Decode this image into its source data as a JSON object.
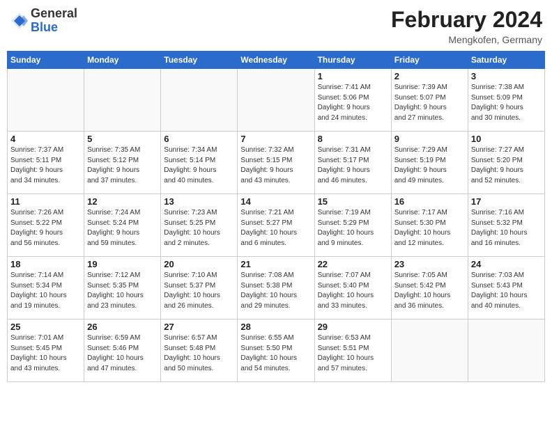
{
  "header": {
    "logo_general": "General",
    "logo_blue": "Blue",
    "month_year": "February 2024",
    "location": "Mengkofen, Germany"
  },
  "weekdays": [
    "Sunday",
    "Monday",
    "Tuesday",
    "Wednesday",
    "Thursday",
    "Friday",
    "Saturday"
  ],
  "weeks": [
    [
      {
        "day": "",
        "info": ""
      },
      {
        "day": "",
        "info": ""
      },
      {
        "day": "",
        "info": ""
      },
      {
        "day": "",
        "info": ""
      },
      {
        "day": "1",
        "info": "Sunrise: 7:41 AM\nSunset: 5:06 PM\nDaylight: 9 hours\nand 24 minutes."
      },
      {
        "day": "2",
        "info": "Sunrise: 7:39 AM\nSunset: 5:07 PM\nDaylight: 9 hours\nand 27 minutes."
      },
      {
        "day": "3",
        "info": "Sunrise: 7:38 AM\nSunset: 5:09 PM\nDaylight: 9 hours\nand 30 minutes."
      }
    ],
    [
      {
        "day": "4",
        "info": "Sunrise: 7:37 AM\nSunset: 5:11 PM\nDaylight: 9 hours\nand 34 minutes."
      },
      {
        "day": "5",
        "info": "Sunrise: 7:35 AM\nSunset: 5:12 PM\nDaylight: 9 hours\nand 37 minutes."
      },
      {
        "day": "6",
        "info": "Sunrise: 7:34 AM\nSunset: 5:14 PM\nDaylight: 9 hours\nand 40 minutes."
      },
      {
        "day": "7",
        "info": "Sunrise: 7:32 AM\nSunset: 5:15 PM\nDaylight: 9 hours\nand 43 minutes."
      },
      {
        "day": "8",
        "info": "Sunrise: 7:31 AM\nSunset: 5:17 PM\nDaylight: 9 hours\nand 46 minutes."
      },
      {
        "day": "9",
        "info": "Sunrise: 7:29 AM\nSunset: 5:19 PM\nDaylight: 9 hours\nand 49 minutes."
      },
      {
        "day": "10",
        "info": "Sunrise: 7:27 AM\nSunset: 5:20 PM\nDaylight: 9 hours\nand 52 minutes."
      }
    ],
    [
      {
        "day": "11",
        "info": "Sunrise: 7:26 AM\nSunset: 5:22 PM\nDaylight: 9 hours\nand 56 minutes."
      },
      {
        "day": "12",
        "info": "Sunrise: 7:24 AM\nSunset: 5:24 PM\nDaylight: 9 hours\nand 59 minutes."
      },
      {
        "day": "13",
        "info": "Sunrise: 7:23 AM\nSunset: 5:25 PM\nDaylight: 10 hours\nand 2 minutes."
      },
      {
        "day": "14",
        "info": "Sunrise: 7:21 AM\nSunset: 5:27 PM\nDaylight: 10 hours\nand 6 minutes."
      },
      {
        "day": "15",
        "info": "Sunrise: 7:19 AM\nSunset: 5:29 PM\nDaylight: 10 hours\nand 9 minutes."
      },
      {
        "day": "16",
        "info": "Sunrise: 7:17 AM\nSunset: 5:30 PM\nDaylight: 10 hours\nand 12 minutes."
      },
      {
        "day": "17",
        "info": "Sunrise: 7:16 AM\nSunset: 5:32 PM\nDaylight: 10 hours\nand 16 minutes."
      }
    ],
    [
      {
        "day": "18",
        "info": "Sunrise: 7:14 AM\nSunset: 5:34 PM\nDaylight: 10 hours\nand 19 minutes."
      },
      {
        "day": "19",
        "info": "Sunrise: 7:12 AM\nSunset: 5:35 PM\nDaylight: 10 hours\nand 23 minutes."
      },
      {
        "day": "20",
        "info": "Sunrise: 7:10 AM\nSunset: 5:37 PM\nDaylight: 10 hours\nand 26 minutes."
      },
      {
        "day": "21",
        "info": "Sunrise: 7:08 AM\nSunset: 5:38 PM\nDaylight: 10 hours\nand 29 minutes."
      },
      {
        "day": "22",
        "info": "Sunrise: 7:07 AM\nSunset: 5:40 PM\nDaylight: 10 hours\nand 33 minutes."
      },
      {
        "day": "23",
        "info": "Sunrise: 7:05 AM\nSunset: 5:42 PM\nDaylight: 10 hours\nand 36 minutes."
      },
      {
        "day": "24",
        "info": "Sunrise: 7:03 AM\nSunset: 5:43 PM\nDaylight: 10 hours\nand 40 minutes."
      }
    ],
    [
      {
        "day": "25",
        "info": "Sunrise: 7:01 AM\nSunset: 5:45 PM\nDaylight: 10 hours\nand 43 minutes."
      },
      {
        "day": "26",
        "info": "Sunrise: 6:59 AM\nSunset: 5:46 PM\nDaylight: 10 hours\nand 47 minutes."
      },
      {
        "day": "27",
        "info": "Sunrise: 6:57 AM\nSunset: 5:48 PM\nDaylight: 10 hours\nand 50 minutes."
      },
      {
        "day": "28",
        "info": "Sunrise: 6:55 AM\nSunset: 5:50 PM\nDaylight: 10 hours\nand 54 minutes."
      },
      {
        "day": "29",
        "info": "Sunrise: 6:53 AM\nSunset: 5:51 PM\nDaylight: 10 hours\nand 57 minutes."
      },
      {
        "day": "",
        "info": ""
      },
      {
        "day": "",
        "info": ""
      }
    ]
  ]
}
